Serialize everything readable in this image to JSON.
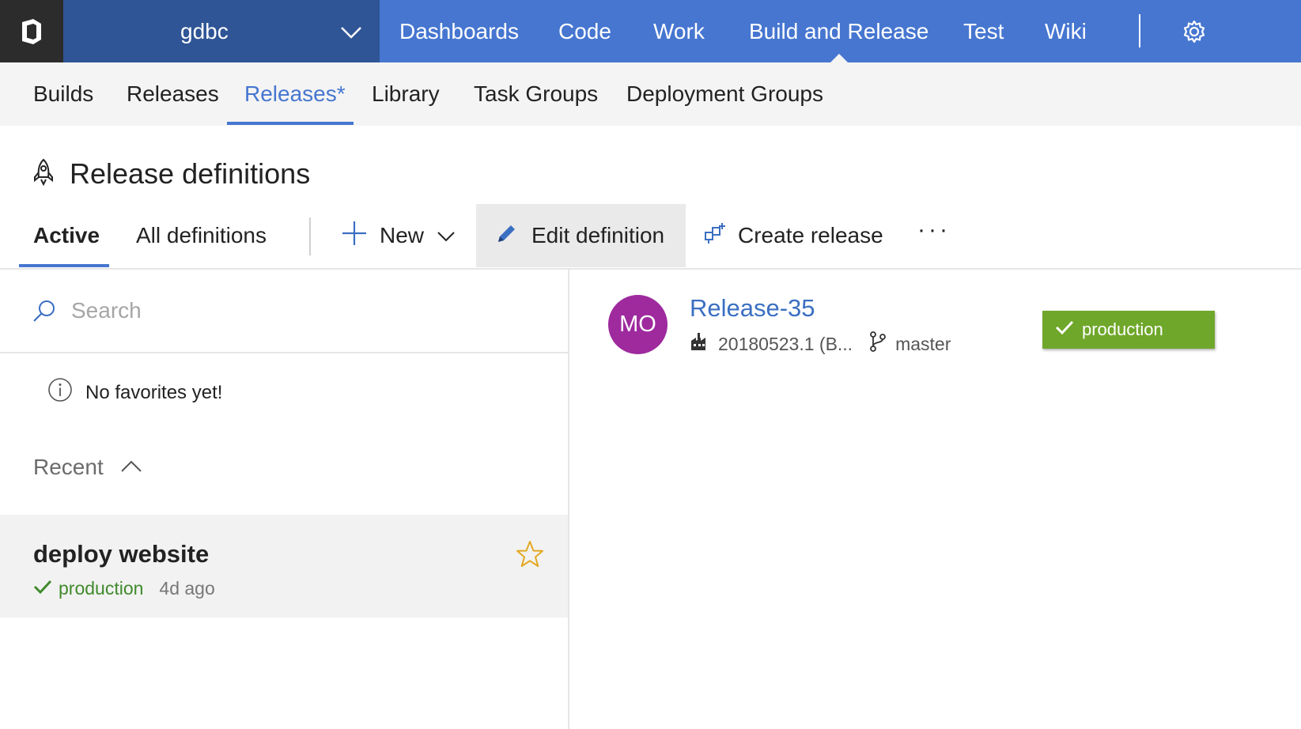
{
  "header": {
    "project_name": "gdbc",
    "hubs": [
      "Dashboards",
      "Code",
      "Work",
      "Build and Release",
      "Test",
      "Wiki"
    ],
    "active_hub": "Build and Release",
    "accent_color": "#4676d0"
  },
  "subnav": {
    "tabs": [
      "Builds",
      "Releases",
      "Releases*",
      "Library",
      "Task Groups",
      "Deployment Groups"
    ],
    "active_tab": "Releases*"
  },
  "page": {
    "title": "Release definitions"
  },
  "toolbar": {
    "pivots": [
      "Active",
      "All definitions"
    ],
    "active_pivot": "Active",
    "new_label": "New",
    "edit_label": "Edit definition",
    "create_label": "Create release",
    "more_label": "···"
  },
  "left": {
    "search_placeholder": "Search",
    "no_favorites": "No favorites yet!",
    "recent_label": "Recent",
    "definitions": [
      {
        "name": "deploy website",
        "environment": "production",
        "time": "4d ago"
      }
    ]
  },
  "release": {
    "avatar_initials": "MO",
    "avatar_color": "#9e2a9e",
    "name": "Release-35",
    "build": "20180523.1 (B...",
    "branch": "master",
    "environment": "production",
    "environment_color": "#6fa72a"
  }
}
